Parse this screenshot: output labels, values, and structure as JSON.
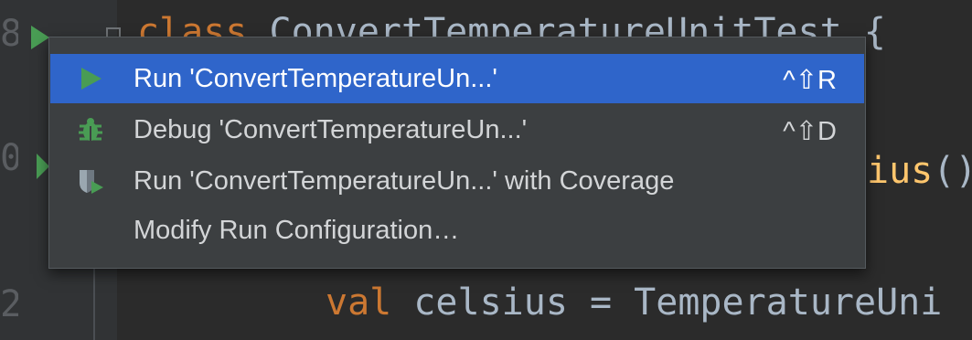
{
  "editor": {
    "code_line_1": {
      "keyword": "class",
      "name": "ConvertTemperatureUnitTest",
      "brace": "{"
    },
    "code_line_2": {
      "function_tail": "ius",
      "parens": "()"
    },
    "code_line_3": {
      "keyword": "val",
      "rest": "celsius = TemperatureUni"
    }
  },
  "popup_menu": {
    "items": [
      {
        "label": "Run 'ConvertTemperatureUn...'",
        "shortcut": "^⇧R",
        "icon": "run-icon",
        "selected": true
      },
      {
        "label": "Debug 'ConvertTemperatureUn...'",
        "shortcut": "^⇧D",
        "icon": "debug-icon",
        "selected": false
      },
      {
        "label": "Run 'ConvertTemperatureUn...' with Coverage",
        "shortcut": "",
        "icon": "coverage-icon",
        "selected": false
      },
      {
        "label": "Modify Run Configuration…",
        "shortcut": "",
        "icon": "",
        "selected": false
      }
    ]
  },
  "colors": {
    "editor_bg": "#2b2b2b",
    "popup_bg": "#3c3f41",
    "selection": "#2f65ca",
    "run_green": "#499c54",
    "keyword": "#cc7832",
    "function": "#ffc66d",
    "text": "#a9b7c6"
  }
}
